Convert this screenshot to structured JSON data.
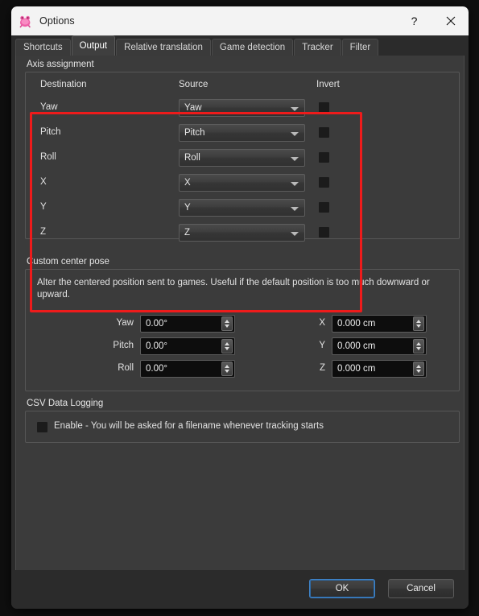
{
  "window": {
    "title": "Options",
    "icon": "opentrack-frog-icon",
    "help_label": "?",
    "close_label": "×"
  },
  "tabs": [
    {
      "label": "Shortcuts",
      "active": false
    },
    {
      "label": "Output",
      "active": true
    },
    {
      "label": "Relative translation",
      "active": false
    },
    {
      "label": "Game detection",
      "active": false
    },
    {
      "label": "Tracker",
      "active": false
    },
    {
      "label": "Filter",
      "active": false
    }
  ],
  "axis_assignment": {
    "title": "Axis assignment",
    "headers": {
      "destination": "Destination",
      "source": "Source",
      "invert": "Invert"
    },
    "rows": [
      {
        "destination": "Yaw",
        "source": "Yaw",
        "invert": false
      },
      {
        "destination": "Pitch",
        "source": "Pitch",
        "invert": false
      },
      {
        "destination": "Roll",
        "source": "Roll",
        "invert": false
      },
      {
        "destination": "X",
        "source": "X",
        "invert": false
      },
      {
        "destination": "Y",
        "source": "Y",
        "invert": false
      },
      {
        "destination": "Z",
        "source": "Z",
        "invert": false
      }
    ],
    "highlight_color": "#ee1b1b"
  },
  "custom_center_pose": {
    "title": "Custom center pose",
    "description": "Alter the centered position sent to games. Useful if the default position is too much downward or upward.",
    "rotation": [
      {
        "label": "Yaw",
        "value": "0.00°"
      },
      {
        "label": "Pitch",
        "value": "0.00°"
      },
      {
        "label": "Roll",
        "value": "0.00°"
      }
    ],
    "translation": [
      {
        "label": "X",
        "value": "0.000 cm"
      },
      {
        "label": "Y",
        "value": "0.000 cm"
      },
      {
        "label": "Z",
        "value": "0.000 cm"
      }
    ]
  },
  "csv_logging": {
    "title": "CSV Data Logging",
    "enable_label": "Enable - You will be asked for a filename whenever tracking starts",
    "enabled": false
  },
  "footer": {
    "ok_label": "OK",
    "cancel_label": "Cancel"
  }
}
